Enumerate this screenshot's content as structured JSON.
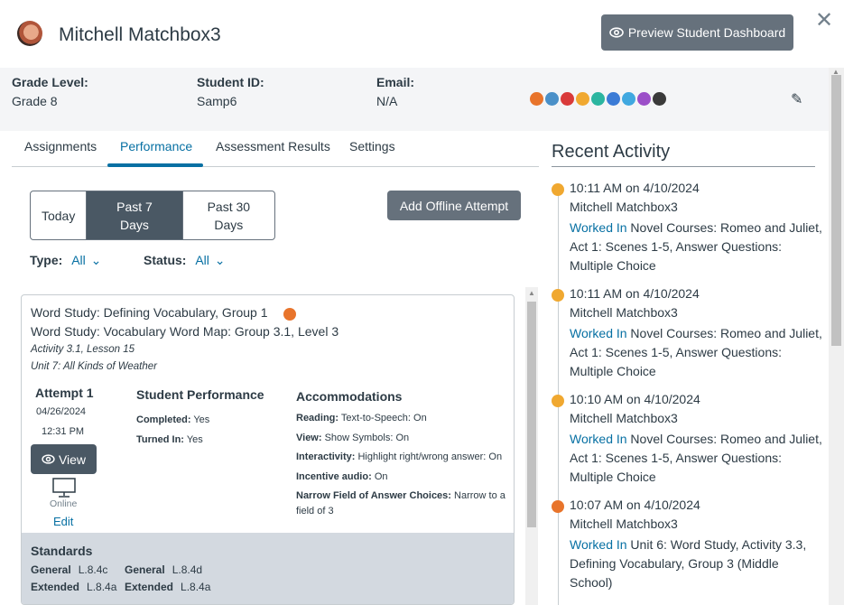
{
  "header": {
    "student_name": "Mitchell Matchbox3",
    "preview_button": "Preview Student Dashboard",
    "close": "✕"
  },
  "info": {
    "grade_label": "Grade Level:",
    "grade_value": "Grade 8",
    "id_label": "Student ID:",
    "id_value": "Samp6",
    "email_label": "Email:",
    "email_value": "N/A",
    "badge_colors": [
      "#e8742b",
      "#4a90c8",
      "#d93a3a",
      "#f0a830",
      "#2bb5a0",
      "#3b7bd6",
      "#40a8e0",
      "#9b4fc8",
      "#3a3a3a"
    ]
  },
  "tabs": {
    "assignments": "Assignments",
    "performance": "Performance",
    "assessment": "Assessment Results",
    "settings": "Settings"
  },
  "range": {
    "today": "Today",
    "past7": "Past 7 Days",
    "past30": "Past 30 Days"
  },
  "offline_button": "Add Offline Attempt",
  "filters": {
    "type_label": "Type:",
    "type_value": "All",
    "status_label": "Status:",
    "status_value": "All"
  },
  "card": {
    "line1": "Word Study: Defining Vocabulary, Group 1",
    "line2": "Word Study: Vocabulary Word Map: Group 3.1, Level 3",
    "activity": "Activity 3.1, Lesson 15",
    "unit": "Unit 7: All Kinds of Weather",
    "attempt": "Attempt 1",
    "date": "04/26/2024",
    "time": "12:31 PM",
    "view": "View",
    "online": "Online",
    "edit": "Edit",
    "performance_title": "Student Performance",
    "completed_label": "Completed:",
    "completed_value": "Yes",
    "turned_label": "Turned In:",
    "turned_value": "Yes",
    "accommodations_title": "Accommodations",
    "acc": [
      {
        "label": "Reading:",
        "value": "Text-to-Speech: On"
      },
      {
        "label": "View:",
        "value": "Show Symbols: On"
      },
      {
        "label": "Interactivity:",
        "value": "Highlight right/wrong answer: On"
      },
      {
        "label": "Incentive audio:",
        "value": "On"
      },
      {
        "label": "Narrow Field of Answer Choices:",
        "value": "Narrow to a field of 3"
      }
    ],
    "standards_title": "Standards",
    "standards": [
      {
        "type": "General",
        "code": "L.8.4c"
      },
      {
        "type": "General",
        "code": "L.8.4d"
      },
      {
        "type": "Extended",
        "code": "L.8.4a"
      },
      {
        "type": "Extended",
        "code": "L.8.4a"
      }
    ]
  },
  "recent": {
    "title": "Recent Activity",
    "items": [
      {
        "time": "10:11 AM on 4/10/2024",
        "who": "Mitchell Matchbox3",
        "verb": "Worked In",
        "what": " Novel Courses: Romeo and Juliet, Act 1: Scenes 1-5, Answer Questions: Multiple Choice",
        "color": "#f0a830"
      },
      {
        "time": "10:11 AM on 4/10/2024",
        "who": "Mitchell Matchbox3",
        "verb": "Worked In",
        "what": " Novel Courses: Romeo and Juliet, Act 1: Scenes 1-5, Answer Questions: Multiple Choice",
        "color": "#f0a830"
      },
      {
        "time": "10:10 AM on 4/10/2024",
        "who": "Mitchell Matchbox3",
        "verb": "Worked In",
        "what": " Novel Courses: Romeo and Juliet, Act 1: Scenes 1-5, Answer Questions: Multiple Choice",
        "color": "#f0a830"
      },
      {
        "time": "10:07 AM on 4/10/2024",
        "who": "Mitchell Matchbox3",
        "verb": "Worked In",
        "what": " Unit 6: Word Study, Activity 3.3, Defining Vocabulary, Group 3 (Middle School)",
        "color": "#e8742b"
      }
    ]
  }
}
